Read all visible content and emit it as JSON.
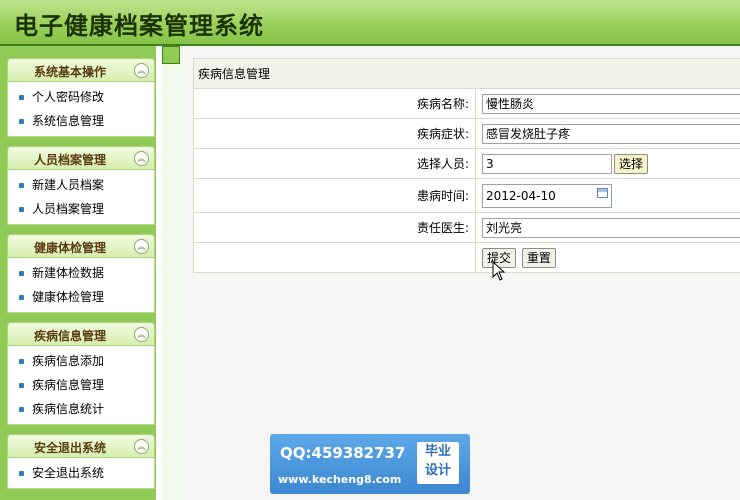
{
  "header": {
    "title": "电子健康档案管理系统"
  },
  "sidebar": {
    "groups": [
      {
        "title": "系统基本操作",
        "items": [
          "个人密码修改",
          "系统信息管理"
        ]
      },
      {
        "title": "人员档案管理",
        "items": [
          "新建人员档案",
          "人员档案管理"
        ]
      },
      {
        "title": "健康体检管理",
        "items": [
          "新建体检数据",
          "健康体检管理"
        ]
      },
      {
        "title": "疾病信息管理",
        "items": [
          "疾病信息添加",
          "疾病信息管理",
          "疾病信息统计"
        ]
      },
      {
        "title": "安全退出系统",
        "items": [
          "安全退出系统"
        ]
      }
    ]
  },
  "form": {
    "caption": "疾病信息管理",
    "fields": [
      {
        "label": "疾病名称:",
        "value": "慢性肠炎"
      },
      {
        "label": "疾病症状:",
        "value": "感冒发烧肚子疼"
      },
      {
        "label": "选择人员:",
        "value": "3"
      },
      {
        "label": "患病时间:",
        "value": "2012-04-10"
      },
      {
        "label": "责任医生:",
        "value": "刘光亮"
      }
    ],
    "select_button": "选择",
    "submit_button": "提交",
    "reset_button": "重置"
  },
  "watermark": {
    "qq": "QQ:459382737",
    "site": "www.kecheng8.com",
    "badge_line1": "毕业",
    "badge_line2": "设计"
  }
}
